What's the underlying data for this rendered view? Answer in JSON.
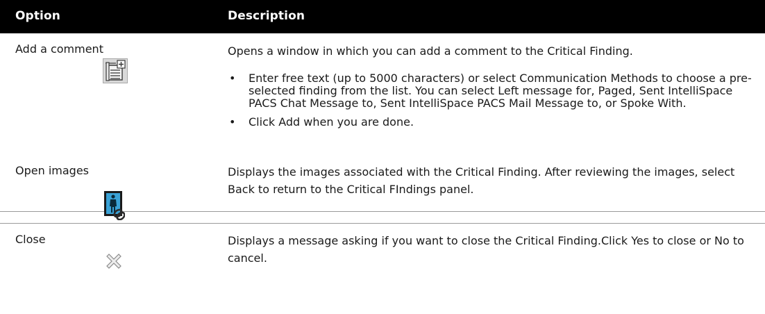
{
  "header": {
    "option": "Option",
    "description": "Description"
  },
  "rows": [
    {
      "option": "Add a comment",
      "icon": "add-comment-icon",
      "description": "Opens a window in which you can add a comment to the Critical Finding.",
      "bullets": [
        "Enter free text (up to 5000 characters) or select Communication Methods to choose a pre-selected finding from the list. You can select Left message for, Paged, Sent IntelliSpace PACS Chat Message to, Sent IntelliSpace PACS Mail Message to, or Spoke With.",
        "Click Add when you are done."
      ]
    },
    {
      "option": "Open images",
      "icon": "open-images-icon",
      "description": "Displays the images associated with the Critical Finding. After reviewing the images, select Back to return to the Critical FIndings panel."
    },
    {
      "option": "Close",
      "icon": "close-icon",
      "description": "Displays a message asking if you want to close the Critical Finding.Click Yes to close or No to cancel."
    }
  ]
}
